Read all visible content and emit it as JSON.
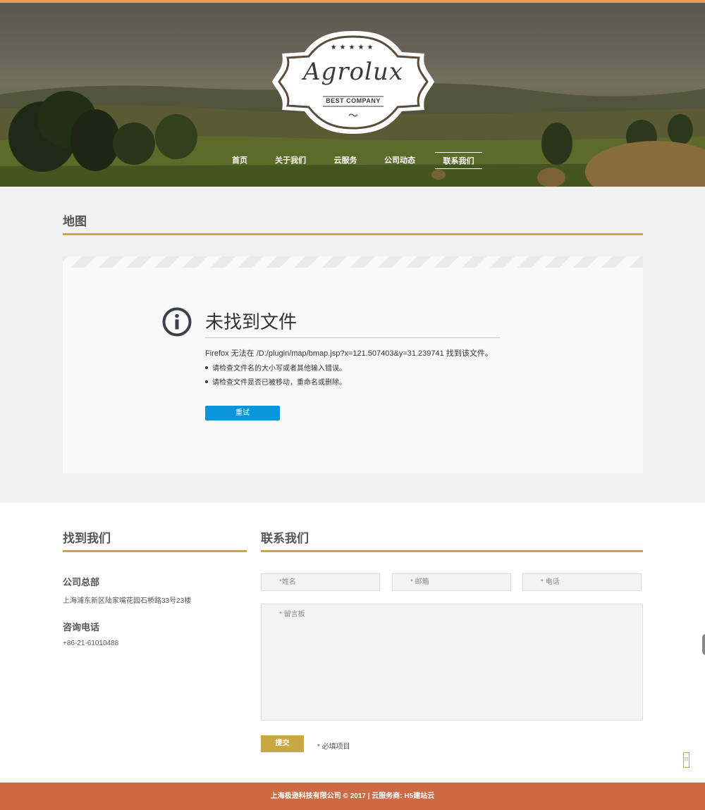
{
  "header": {
    "brand": "Agrolux",
    "tagline": "BEST COMPANY",
    "stars": "★★★★★",
    "flourish": "〜",
    "nav": [
      {
        "label": "首页"
      },
      {
        "label": "关于我们"
      },
      {
        "label": "云服务"
      },
      {
        "label": "公司动态"
      },
      {
        "label": "联系我们",
        "active": true
      }
    ]
  },
  "map_section": {
    "title": "地图",
    "error": {
      "title": "未找到文件",
      "message": "Firefox 无法在 /D:/plugin/map/bmap.jsp?x=121.507403&y=31.239741 找到该文件。",
      "tips": [
        "请检查文件名的大小写或者其他输入错误。",
        "请检查文件是否已被移动，重命名或删除。"
      ],
      "retry_label": "重试"
    }
  },
  "find_us": {
    "title": "找到我们",
    "hq_label": "公司总部",
    "hq_address": "上海浦东新区陆家嘴花园石桥路33号23楼",
    "phone_label": "咨询电话",
    "phone": "+86-21-61010488"
  },
  "contact_form": {
    "title": "联系我们",
    "name_placeholder": "*姓名",
    "email_placeholder": "* 邮箱",
    "phone_placeholder": "* 电话",
    "message_placeholder": "* 留言板",
    "submit_label": "提交",
    "required_note": "* 必填项目"
  },
  "side_tab_label": "回",
  "footer": {
    "text": "上海极逊科技有限公司 © 2017 | 云服务商: H5建站云"
  },
  "colors": {
    "accent_gold": "#c9a844",
    "footer_bg": "#cd6a43",
    "top_bar": "#f39a4a",
    "retry_blue": "#0996d9"
  }
}
